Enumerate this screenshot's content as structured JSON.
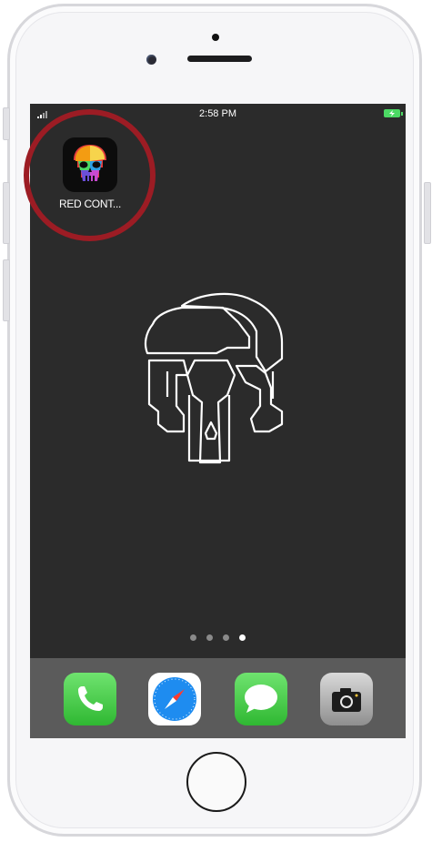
{
  "status_bar": {
    "time": "2:58 PM"
  },
  "home_screen": {
    "apps": [
      {
        "label": "RED CONT...",
        "icon": "rainbow-skull-icon"
      }
    ],
    "page_indicator": {
      "count": 4,
      "active_index": 3
    }
  },
  "dock": {
    "apps": [
      {
        "icon": "phone-icon",
        "color": "#4cd964"
      },
      {
        "icon": "safari-compass-icon",
        "color": "#1e8cf0"
      },
      {
        "icon": "messages-bubble-icon",
        "color": "#4cd964"
      },
      {
        "icon": "camera-icon",
        "color": "#9b9b9b"
      }
    ]
  },
  "colors": {
    "highlight_ring": "#9c1c24",
    "wallpaper": "#2b2b2b",
    "dock": "#5b5b5b"
  }
}
